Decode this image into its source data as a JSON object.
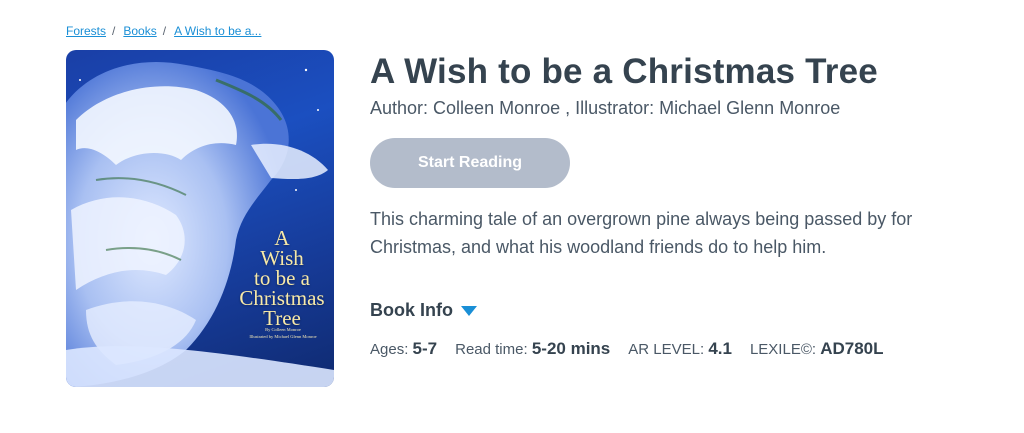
{
  "breadcrumb": {
    "items": [
      "Forests",
      "Books",
      "A Wish to be a..."
    ],
    "separator": "/"
  },
  "cover": {
    "title_lines": [
      "A",
      "Wish",
      "to be a",
      "Christmas",
      "Tree"
    ],
    "credits": [
      "By Colleen Monroe",
      "Illustrated by Michael Glenn Monroe"
    ]
  },
  "book": {
    "title": "A Wish to be a Christmas Tree",
    "byline": "Author: Colleen Monroe , Illustrator: Michael Glenn Monroe",
    "start_label": "Start Reading",
    "description": "This charming tale of an overgrown pine always being passed by for Christmas, and what his woodland friends do to help him.",
    "info_label": "Book Info",
    "meta": {
      "ages_label": "Ages:",
      "ages_value": "5-7",
      "read_label": "Read time:",
      "read_value": "5-20 mins",
      "ar_label": "AR LEVEL:",
      "ar_value": "4.1",
      "lexile_label": "LEXILE©:",
      "lexile_value": "AD780L"
    }
  },
  "colors": {
    "link": "#1a8fd6",
    "button_disabled": "#b3bccb",
    "heading": "#35434f",
    "cover_blue": "#1b4fc0"
  }
}
